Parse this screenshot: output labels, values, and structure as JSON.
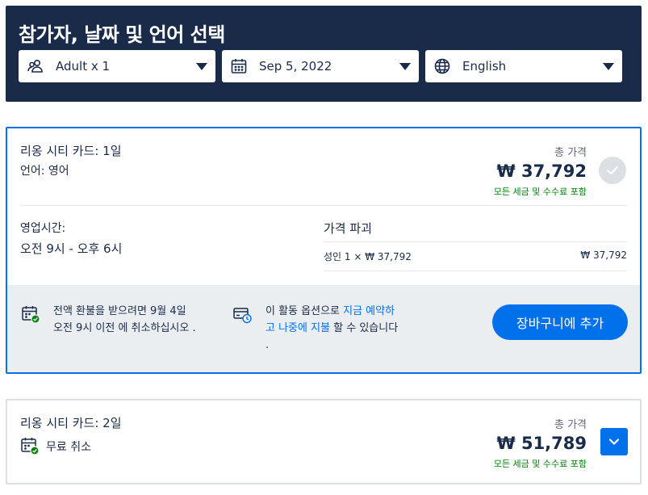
{
  "header": {
    "title": "참가자, 날짜 및 언어 선택",
    "participants": "Adult x 1",
    "date": "Sep 5, 2022",
    "language": "English"
  },
  "option1": {
    "title": "리옹 시티 카드: 1일",
    "language_line": "언어: 영어",
    "price_label": "총 가격",
    "price": "₩ 37,792",
    "price_note": "모든 세금 및 수수료 포함",
    "hours_label": "영업시간:",
    "hours": "오전 9시 - 오후 6시",
    "breakdown_title": "가격 파괴",
    "breakdown_row_label": "성인 1 × ₩ 37,792",
    "breakdown_row_value": "₩ 37,792",
    "cancel_text_1": "전액 환불을 받으려면 9월 4일",
    "cancel_text_2": "오전 9시 이전 에 취소하십시오 .",
    "reserve_text_1": "이 활동 옵션으로 ",
    "reserve_link_1": "지금 예약하",
    "reserve_link_2": "고 나중에 지불",
    "reserve_text_2": " 할 수 있습니다",
    "reserve_text_3": ".",
    "cart_button": "장바구니에 추가"
  },
  "option2": {
    "title": "리옹 시티 카드: 2일",
    "free_cancel": "무료 취소",
    "price_label": "총 가격",
    "price": "₩ 51,789",
    "price_note": "모든 세금 및 수수료 포함"
  },
  "colors": {
    "header_bg": "#1a2b49",
    "accent": "#0071eb",
    "success": "#008009"
  }
}
